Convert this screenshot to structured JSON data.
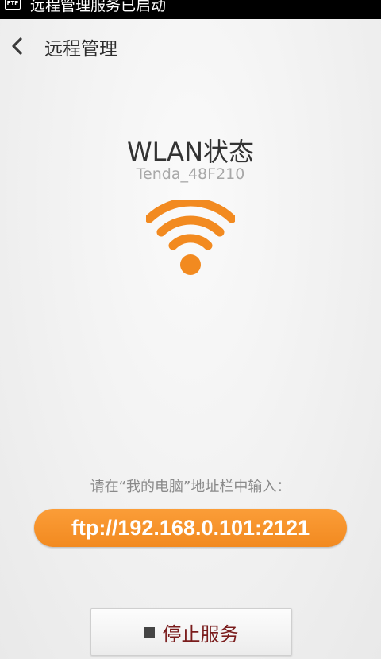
{
  "status_bar": {
    "notification_icon": "FTP",
    "notification_text": "远程管理服务已启动"
  },
  "header": {
    "back_icon": "chevron-left-icon",
    "title": "远程管理"
  },
  "wlan": {
    "title": "WLAN状态",
    "ssid": "Tenda_48F210",
    "icon": "wifi-icon"
  },
  "instructions": {
    "hint": "请在“我的电脑”地址栏中输入：",
    "ftp_address": "ftp://192.168.0.101:2121"
  },
  "actions": {
    "stop_icon": "stop-square-icon",
    "stop_label": "停止服务"
  },
  "colors": {
    "accent": "#f28a20",
    "stop_text": "#7a1c1c"
  }
}
